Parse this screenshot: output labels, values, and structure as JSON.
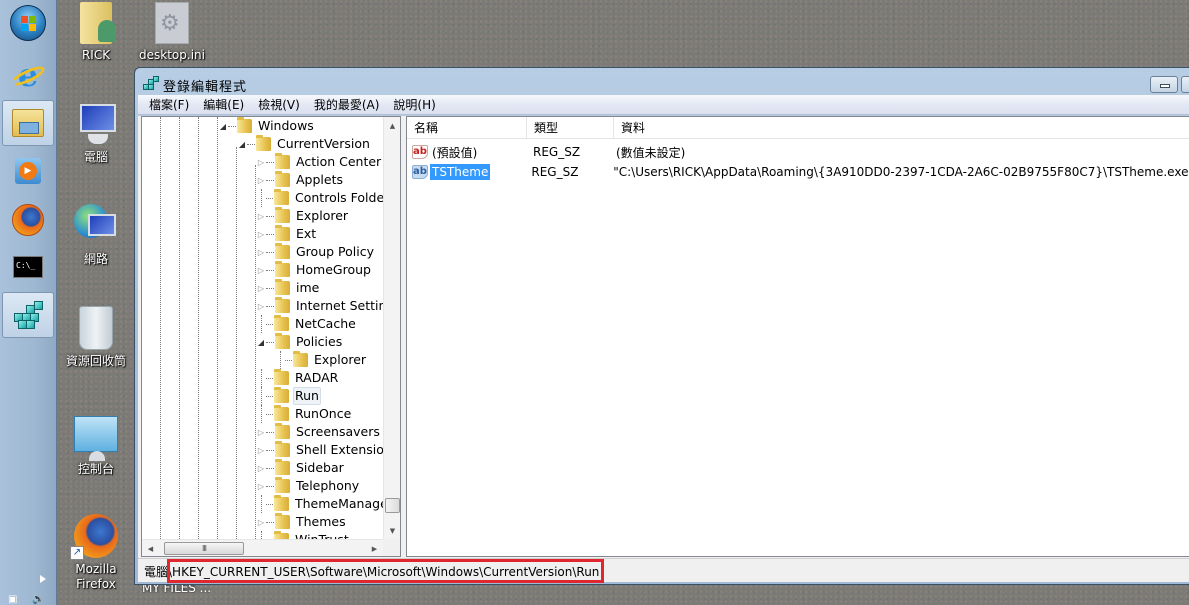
{
  "taskbar": {
    "buttons": [
      {
        "name": "start-button",
        "icon": "windows-orb-icon"
      },
      {
        "name": "internet-explorer",
        "icon": "ie-icon"
      },
      {
        "name": "windows-explorer",
        "icon": "explorer-icon",
        "active": true
      },
      {
        "name": "windows-media-player",
        "icon": "media-player-icon"
      },
      {
        "name": "firefox",
        "icon": "firefox-icon"
      },
      {
        "name": "command-prompt",
        "icon": "cmd-icon",
        "text": "C:\\_"
      },
      {
        "name": "registry-editor",
        "icon": "regedit-icon",
        "active": true
      }
    ]
  },
  "desktop": {
    "icons": [
      {
        "label": "RICK",
        "icon": "user-folder-icon"
      },
      {
        "label": "desktop.ini",
        "icon": "ini-file-icon"
      },
      {
        "label": "電腦",
        "icon": "computer-icon"
      },
      {
        "label": "網路",
        "icon": "network-icon"
      },
      {
        "label": "資源回收筒",
        "icon": "recycle-bin-icon"
      },
      {
        "label": "控制台",
        "icon": "control-panel-icon"
      },
      {
        "label": "Mozilla\nFirefox",
        "line1": "Mozilla",
        "line2": "Firefox",
        "icon": "firefox-shortcut-icon"
      }
    ],
    "partial_label": "MY FILES ..."
  },
  "window": {
    "title": "登錄編輯程式",
    "menu": [
      "檔案(F)",
      "編輯(E)",
      "檢視(V)",
      "我的最愛(A)",
      "說明(H)"
    ],
    "tree": {
      "items": [
        {
          "label": "Windows",
          "level": 0,
          "expander": "open"
        },
        {
          "label": "CurrentVersion",
          "level": 1,
          "expander": "open"
        },
        {
          "label": "Action Center",
          "level": 2,
          "expander": "closed"
        },
        {
          "label": "Applets",
          "level": 2,
          "expander": "closed"
        },
        {
          "label": "Controls Folder",
          "level": 2,
          "expander": "none"
        },
        {
          "label": "Explorer",
          "level": 2,
          "expander": "closed"
        },
        {
          "label": "Ext",
          "level": 2,
          "expander": "closed"
        },
        {
          "label": "Group Policy",
          "level": 2,
          "expander": "closed"
        },
        {
          "label": "HomeGroup",
          "level": 2,
          "expander": "closed"
        },
        {
          "label": "ime",
          "level": 2,
          "expander": "closed"
        },
        {
          "label": "Internet Settings",
          "level": 2,
          "expander": "closed"
        },
        {
          "label": "NetCache",
          "level": 2,
          "expander": "none"
        },
        {
          "label": "Policies",
          "level": 2,
          "expander": "open"
        },
        {
          "label": "Explorer",
          "level": 3,
          "expander": "none"
        },
        {
          "label": "RADAR",
          "level": 2,
          "expander": "none"
        },
        {
          "label": "Run",
          "level": 2,
          "expander": "none",
          "selected": true
        },
        {
          "label": "RunOnce",
          "level": 2,
          "expander": "none"
        },
        {
          "label": "Screensavers",
          "level": 2,
          "expander": "closed"
        },
        {
          "label": "Shell Extensions",
          "level": 2,
          "expander": "closed"
        },
        {
          "label": "Sidebar",
          "level": 2,
          "expander": "closed"
        },
        {
          "label": "Telephony",
          "level": 2,
          "expander": "closed"
        },
        {
          "label": "ThemeManager",
          "level": 2,
          "expander": "none"
        },
        {
          "label": "Themes",
          "level": 2,
          "expander": "closed"
        },
        {
          "label": "WinTrust",
          "level": 2,
          "expander": "none"
        }
      ],
      "hscroll_grip": "III"
    },
    "list": {
      "columns": [
        "名稱",
        "類型",
        "資料"
      ],
      "rows": [
        {
          "name": "(預設值)",
          "type": "REG_SZ",
          "data": "(數值未設定)",
          "icon": "string-value-icon",
          "selected": false
        },
        {
          "name": "TSTheme",
          "type": "REG_SZ",
          "data": "\"C:\\Users\\RICK\\AppData\\Roaming\\{3A910DD0-2397-1CDA-2A6C-02B9755F80C7}\\TSTheme.exe\"",
          "icon": "string-value-icon",
          "selected": true
        }
      ]
    },
    "status": {
      "prefix": "電腦",
      "path": "\\HKEY_CURRENT_USER\\Software\\Microsoft\\Windows\\CurrentVersion\\Run"
    }
  },
  "colors": {
    "selection": "#3399ff",
    "highlight_box": "#e0262f",
    "titlebar": "#a6bfda"
  }
}
